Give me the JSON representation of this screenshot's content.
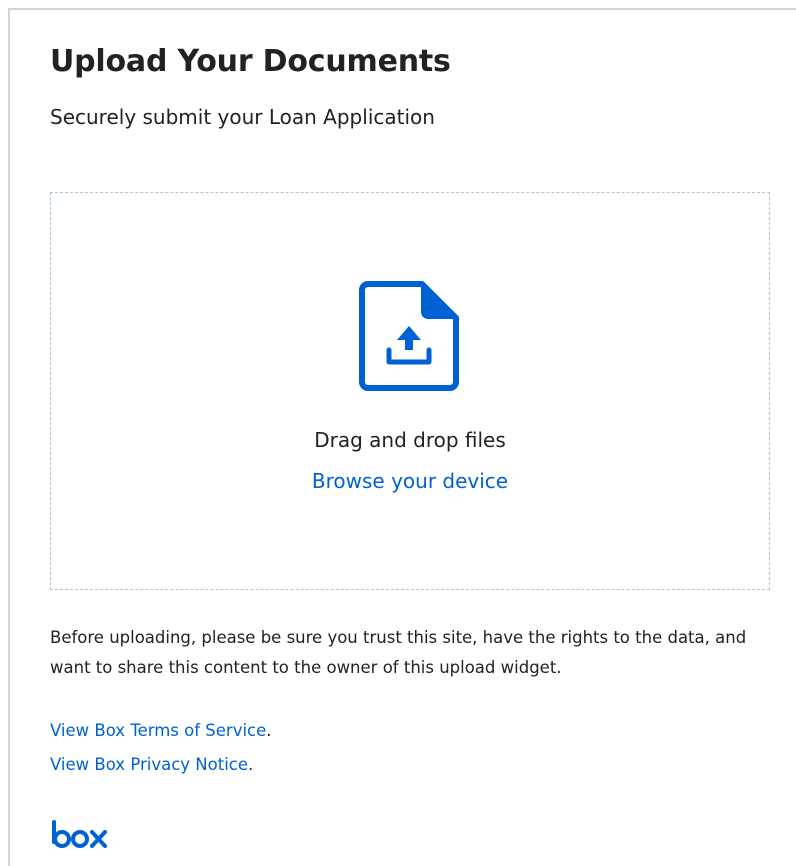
{
  "header": {
    "title": "Upload Your Documents",
    "subtitle": "Securely submit your Loan Application"
  },
  "dropzone": {
    "icon": "file-upload-icon",
    "drag_text": "Drag and drop files",
    "browse_label": "Browse your device"
  },
  "footer": {
    "disclaimer": "Before uploading, please be sure you trust this site, have the rights to the data, and want to share this content to the owner of this upload widget.",
    "terms_link": "View Box Terms of Service",
    "privacy_link": "View Box Privacy Notice",
    "period": ".",
    "logo": "box"
  },
  "colors": {
    "accent": "#0061d5",
    "text": "#222222",
    "dropzone_border": "#a9c6dc",
    "frame_border": "#d3d3d3"
  }
}
